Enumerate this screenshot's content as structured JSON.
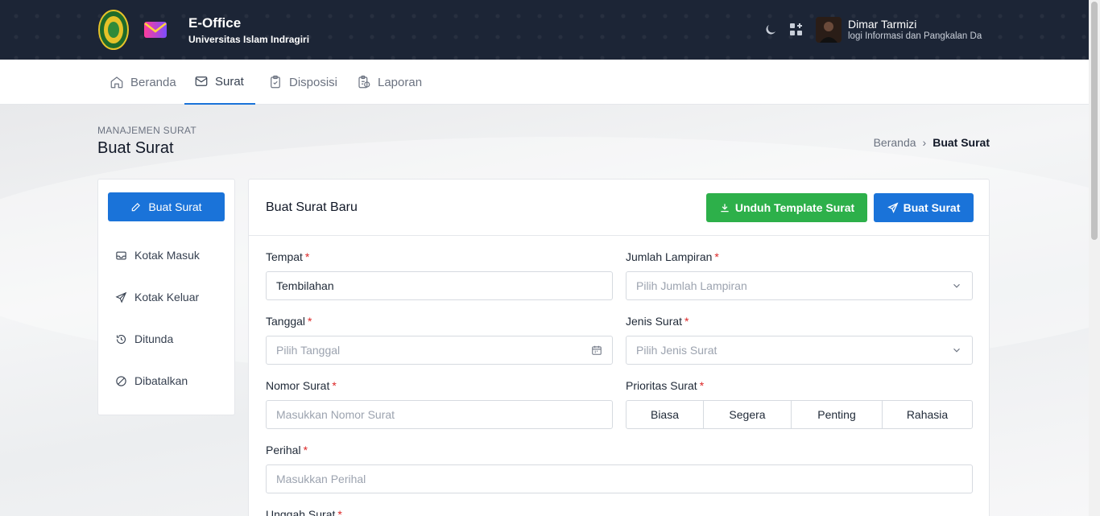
{
  "header": {
    "app_title": "E-Office",
    "app_subtitle": "Universitas Islam Indragiri",
    "user_name": "Dimar Tarmizi",
    "user_department": "logi Informasi dan Pangkalan Da"
  },
  "nav": {
    "items": [
      {
        "label": "Beranda",
        "icon": "home-icon"
      },
      {
        "label": "Surat",
        "icon": "mail-icon",
        "active": true
      },
      {
        "label": "Disposisi",
        "icon": "clipboard-check-icon"
      },
      {
        "label": "Laporan",
        "icon": "report-icon"
      }
    ]
  },
  "page": {
    "section": "MANAJEMEN SURAT",
    "title": "Buat Surat",
    "breadcrumb": [
      "Beranda",
      "›",
      "Buat Surat"
    ]
  },
  "sidebar": {
    "primary_button": "Buat Surat",
    "items": [
      {
        "label": "Kotak Masuk",
        "icon": "inbox-icon"
      },
      {
        "label": "Kotak Keluar",
        "icon": "send-icon"
      },
      {
        "label": "Ditunda",
        "icon": "history-icon"
      },
      {
        "label": "Dibatalkan",
        "icon": "ban-icon"
      }
    ]
  },
  "form": {
    "card_title": "Buat Surat Baru",
    "download_button": "Unduh Template Surat",
    "submit_button": "Buat Surat",
    "tempat": {
      "label": "Tempat",
      "value": "Tembilahan"
    },
    "jumlah_lampiran": {
      "label": "Jumlah Lampiran",
      "placeholder": "Pilih Jumlah Lampiran"
    },
    "tanggal": {
      "label": "Tanggal",
      "placeholder": "Pilih Tanggal"
    },
    "jenis_surat": {
      "label": "Jenis Surat",
      "placeholder": "Pilih Jenis Surat"
    },
    "nomor_surat": {
      "label": "Nomor Surat",
      "placeholder": "Masukkan Nomor Surat"
    },
    "prioritas": {
      "label": "Prioritas Surat",
      "options": [
        "Biasa",
        "Segera",
        "Penting",
        "Rahasia"
      ]
    },
    "perihal": {
      "label": "Perihal",
      "placeholder": "Masukkan Perihal"
    },
    "unggah": {
      "label": "Unggah Surat"
    },
    "required_mark": "*"
  },
  "colors": {
    "primary": "#1a73d9",
    "success": "#2db04a",
    "header_bg": "#1c2536"
  }
}
